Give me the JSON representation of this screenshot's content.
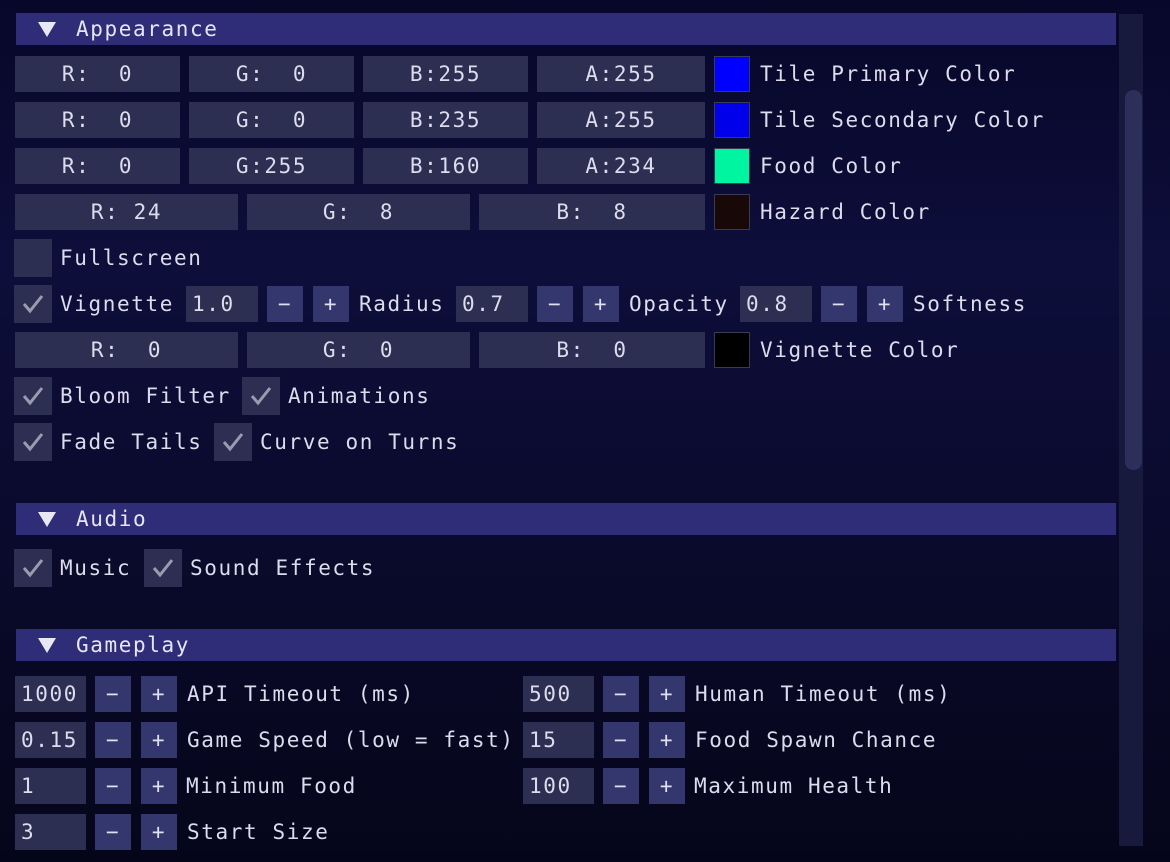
{
  "sections": {
    "appearance": "Appearance",
    "audio": "Audio",
    "gameplay": "Gameplay"
  },
  "appearance": {
    "tile_primary": {
      "r": "R:  0",
      "g": "G:  0",
      "b": "B:255",
      "a": "A:255",
      "label": "Tile Primary Color",
      "color": "#0000ff"
    },
    "tile_secondary": {
      "r": "R:  0",
      "g": "G:  0",
      "b": "B:235",
      "a": "A:255",
      "label": "Tile Secondary Color",
      "color": "#0000eb"
    },
    "food": {
      "r": "R:  0",
      "g": "G:255",
      "b": "B:160",
      "a": "A:234",
      "label": "Food Color",
      "color": "#00ffa0"
    },
    "hazard": {
      "r": "R: 24",
      "g": "G:  8",
      "b": "B:  8",
      "label": "Hazard Color",
      "color": "#180808"
    },
    "fullscreen": {
      "label": "Fullscreen",
      "checked": false
    },
    "vignette": {
      "label": "Vignette",
      "value": "1.0",
      "checked": true
    },
    "radius": {
      "label": "Radius",
      "value": "0.7"
    },
    "opacity": {
      "label": "Opacity",
      "value": "0.8"
    },
    "softness": {
      "label": "Softness"
    },
    "vignette_color": {
      "r": "R:  0",
      "g": "G:  0",
      "b": "B:  0",
      "label": "Vignette Color",
      "color": "#000000"
    },
    "bloom": {
      "label": "Bloom Filter",
      "checked": true
    },
    "animations": {
      "label": "Animations",
      "checked": true
    },
    "fade_tails": {
      "label": "Fade Tails",
      "checked": true
    },
    "curve_turns": {
      "label": "Curve on Turns",
      "checked": true
    }
  },
  "audio": {
    "music": {
      "label": "Music",
      "checked": true
    },
    "sfx": {
      "label": "Sound Effects",
      "checked": true
    }
  },
  "gameplay": {
    "api_timeout": {
      "value": "1000",
      "label": "API Timeout (ms)"
    },
    "human_timeout": {
      "value": "500",
      "label": "Human Timeout (ms)"
    },
    "game_speed": {
      "value": "0.15",
      "label": "Game Speed (low = fast)"
    },
    "food_spawn": {
      "value": "15",
      "label": "Food Spawn Chance"
    },
    "min_food": {
      "value": "1",
      "label": "Minimum Food"
    },
    "max_health": {
      "value": "100",
      "label": "Maximum Health"
    },
    "start_size": {
      "value": "3",
      "label": "Start Size"
    }
  },
  "controls": {
    "minus": "−",
    "plus": "+"
  },
  "icons": {
    "checkbox": "checkmark-icon",
    "collapse": "triangle-down-icon"
  }
}
